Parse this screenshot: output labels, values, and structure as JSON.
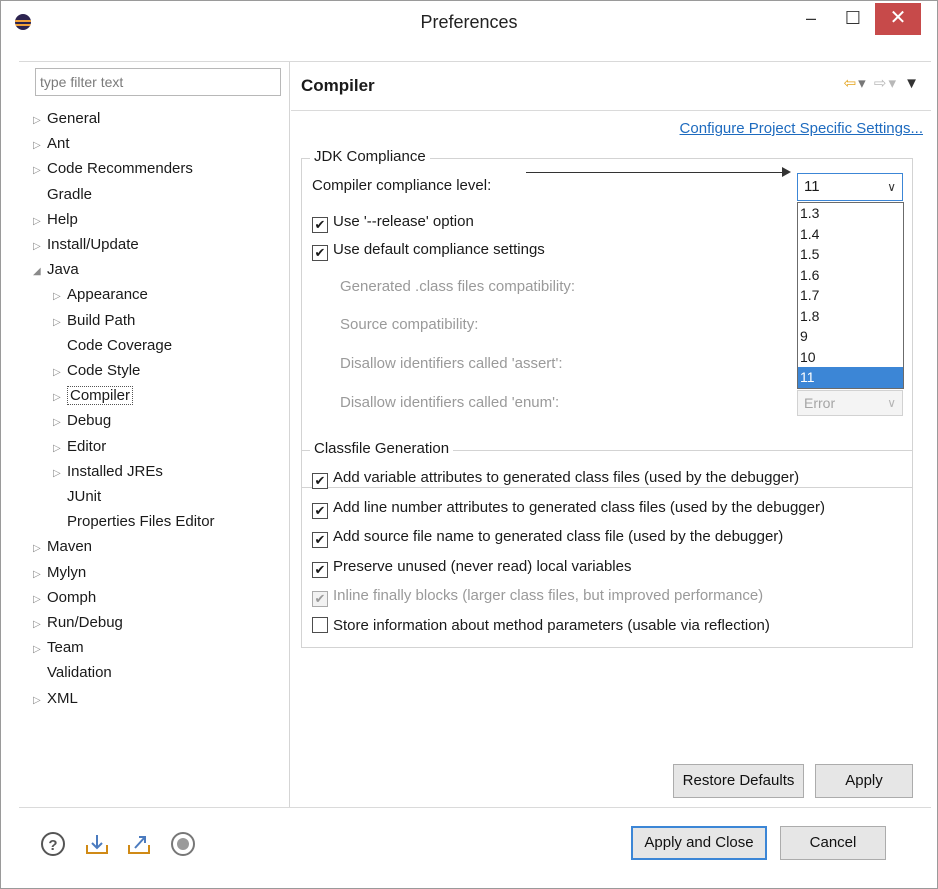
{
  "window": {
    "title": "Preferences",
    "min_label": "–",
    "max_label": "☐",
    "close_label": "✕"
  },
  "filter": {
    "placeholder": "type filter text"
  },
  "tree": [
    {
      "label": "General",
      "expandable": true,
      "level": 0
    },
    {
      "label": "Ant",
      "expandable": true,
      "level": 0
    },
    {
      "label": "Code Recommenders",
      "expandable": true,
      "level": 0
    },
    {
      "label": "Gradle",
      "expandable": false,
      "level": 0
    },
    {
      "label": "Help",
      "expandable": true,
      "level": 0
    },
    {
      "label": "Install/Update",
      "expandable": true,
      "level": 0
    },
    {
      "label": "Java",
      "expandable": true,
      "expanded": true,
      "level": 0
    },
    {
      "label": "Appearance",
      "expandable": true,
      "level": 1
    },
    {
      "label": "Build Path",
      "expandable": true,
      "level": 1
    },
    {
      "label": "Code Coverage",
      "expandable": false,
      "level": 1
    },
    {
      "label": "Code Style",
      "expandable": true,
      "level": 1
    },
    {
      "label": "Compiler",
      "expandable": true,
      "level": 1,
      "selected": true
    },
    {
      "label": "Debug",
      "expandable": true,
      "level": 1
    },
    {
      "label": "Editor",
      "expandable": true,
      "level": 1
    },
    {
      "label": "Installed JREs",
      "expandable": true,
      "level": 1
    },
    {
      "label": "JUnit",
      "expandable": false,
      "level": 1
    },
    {
      "label": "Properties Files Editor",
      "expandable": false,
      "level": 1
    },
    {
      "label": "Maven",
      "expandable": true,
      "level": 0
    },
    {
      "label": "Mylyn",
      "expandable": true,
      "level": 0
    },
    {
      "label": "Oomph",
      "expandable": true,
      "level": 0
    },
    {
      "label": "Run/Debug",
      "expandable": true,
      "level": 0
    },
    {
      "label": "Team",
      "expandable": true,
      "level": 0
    },
    {
      "label": "Validation",
      "expandable": false,
      "level": 0
    },
    {
      "label": "XML",
      "expandable": true,
      "level": 0
    }
  ],
  "page": {
    "title": "Compiler",
    "config_link": "Configure Project Specific Settings..."
  },
  "jdk": {
    "group_title": "JDK Compliance",
    "compliance_label": "Compiler compliance level:",
    "compliance_value": "11",
    "release_option": {
      "label": "Use '--release' option",
      "checked": true
    },
    "default_settings": {
      "label": "Use default compliance settings",
      "checked": true
    },
    "generated_label": "Generated .class files compatibility:",
    "source_label": "Source compatibility:",
    "assert_label": "Disallow identifiers called 'assert':",
    "enum_label": "Disallow identifiers called 'enum':",
    "enum_value": "Error",
    "dropdown_options": [
      "1.3",
      "1.4",
      "1.5",
      "1.6",
      "1.7",
      "1.8",
      "9",
      "10",
      "11"
    ],
    "dropdown_selected": "11"
  },
  "classfile": {
    "group_title": "Classfile Generation",
    "options": [
      {
        "label": "Add variable attributes to generated class files (used by the debugger)",
        "checked": true,
        "disabled": false
      },
      {
        "label": "Add line number attributes to generated class files (used by the debugger)",
        "checked": true,
        "disabled": false
      },
      {
        "label": "Add source file name to generated class file (used by the debugger)",
        "checked": true,
        "disabled": false
      },
      {
        "label": "Preserve unused (never read) local variables",
        "checked": true,
        "disabled": false
      },
      {
        "label": "Inline finally blocks (larger class files, but improved performance)",
        "checked": true,
        "disabled": true
      },
      {
        "label": "Store information about method parameters (usable via reflection)",
        "checked": false,
        "disabled": false
      }
    ]
  },
  "buttons": {
    "restore_defaults": "Restore Defaults",
    "apply": "Apply",
    "apply_and_close": "Apply and Close",
    "cancel": "Cancel"
  },
  "footer_icons": [
    "help-icon",
    "import-icon",
    "export-icon",
    "record-icon"
  ],
  "colors": {
    "accent": "#3c86d6",
    "link": "#1e6bbf",
    "close_button": "#c74a4a",
    "nav_back": "#e3a21a"
  }
}
